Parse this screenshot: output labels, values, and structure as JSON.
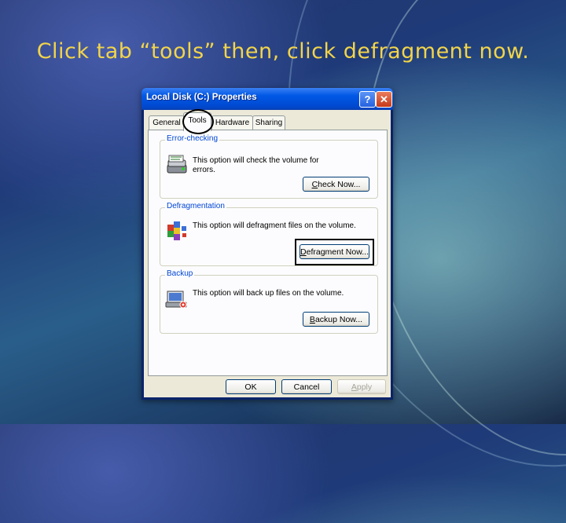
{
  "instruction": "Click tab “tools” then, click defragment now.",
  "dialog": {
    "title": "Local Disk (C:) Properties",
    "help_glyph": "?",
    "close_glyph": "✕",
    "tabs": [
      {
        "label": "General"
      },
      {
        "label": "Tools",
        "selected": true
      },
      {
        "label": "Hardware"
      },
      {
        "label": "Sharing"
      }
    ],
    "groups": {
      "error_checking": {
        "label": "Error-checking",
        "text_line1": "This option will check the volume for",
        "text_line2": "errors.",
        "button_u": "C",
        "button_rest": "heck Now...",
        "icon": "checkdisk-icon"
      },
      "defrag": {
        "label": "Defragmentation",
        "text": "This option will defragment files on the volume.",
        "button_u": "D",
        "button_rest": "efragment Now...",
        "icon": "defrag-icon"
      },
      "backup": {
        "label": "Backup",
        "text": "This option will back up files on the volume.",
        "button_u": "B",
        "button_rest": "ackup Now...",
        "icon": "backup-icon"
      }
    },
    "footer": {
      "ok": "OK",
      "cancel": "Cancel",
      "apply_u": "A",
      "apply_rest": "pply"
    },
    "colors": {
      "titlebar": "#0058e6",
      "group_label": "#0046d5",
      "instruction": "#f2d44a"
    }
  }
}
